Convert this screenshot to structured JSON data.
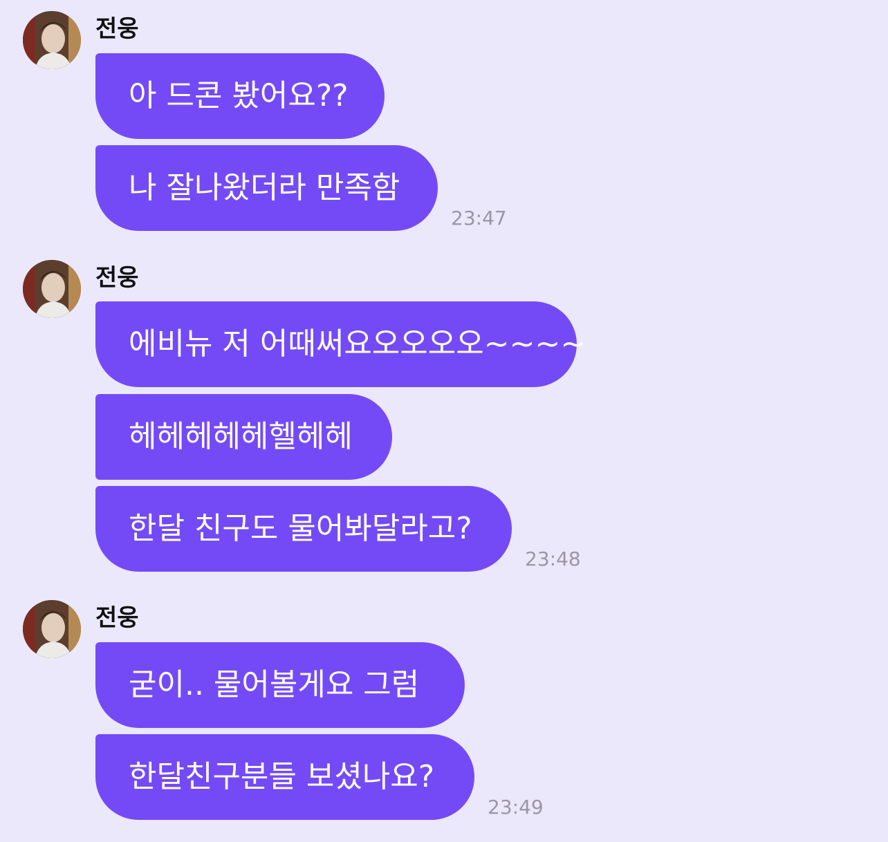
{
  "groups": [
    {
      "sender": "전웅",
      "messages": [
        "아 드콘 봤어요??",
        "나 잘나왔더라 만족함"
      ],
      "time": "23:47"
    },
    {
      "sender": "전웅",
      "messages": [
        "에비뉴 저 어때써요오오오오~~~~",
        "헤헤헤헤헤헬헤헤",
        "한달 친구도 물어봐달라고?"
      ],
      "time": "23:48"
    },
    {
      "sender": "전웅",
      "messages": [
        "굳이.. 물어볼게요 그럼",
        "한달친구분들 보셨나요?"
      ],
      "time": "23:49"
    }
  ],
  "colors": {
    "background": "#ECE8FB",
    "bubble": "#744AF7",
    "bubble_text": "#FFFFFF",
    "time_text": "#9A96A6"
  },
  "icons": [
    "avatar-photo"
  ]
}
